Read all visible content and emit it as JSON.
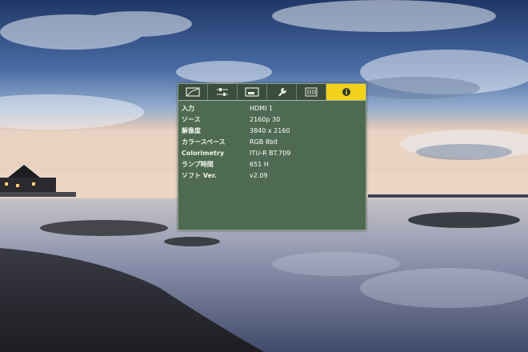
{
  "osd": {
    "tabs": [
      {
        "icon": "picture-icon",
        "active": false
      },
      {
        "icon": "sliders-icon",
        "active": false
      },
      {
        "icon": "screen-icon",
        "active": false
      },
      {
        "icon": "wrench-icon",
        "active": false
      },
      {
        "icon": "panel-icon",
        "active": false
      },
      {
        "icon": "info-icon",
        "active": true
      }
    ],
    "rows": [
      {
        "label": "入力",
        "value": "HDMI 1"
      },
      {
        "label": "ソース",
        "value": "2160p 30"
      },
      {
        "label": "解像度",
        "value": "3840 x 2160"
      },
      {
        "label": "カラースペース",
        "value": "RGB 8bit"
      },
      {
        "label": "Colorimetry",
        "value": "ITU-R BT.709"
      },
      {
        "label": "ランプ時間",
        "value": "651 H"
      },
      {
        "label": "ソフト Ver.",
        "value": "v2.09"
      }
    ],
    "colors": {
      "panel": "#4f6a52",
      "tab_active": "#f2d21a",
      "text": "#f0f4ea"
    }
  }
}
